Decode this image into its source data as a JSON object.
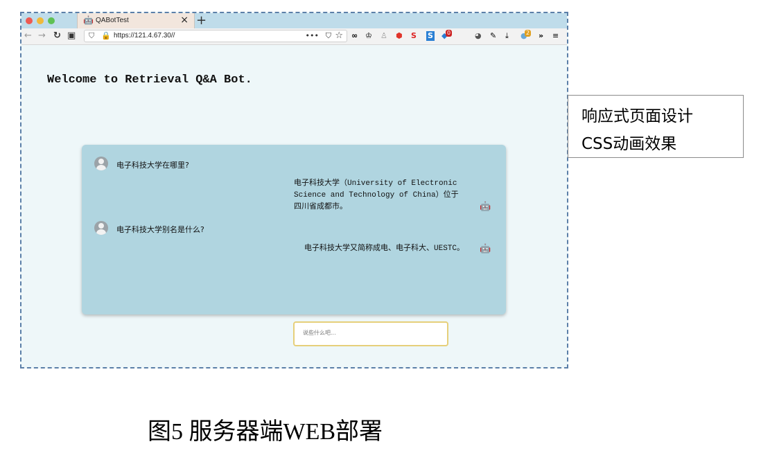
{
  "browser": {
    "tab_title": "QABotTest",
    "url": "https://121.4.67.30//",
    "extension_badge": "2",
    "extension_badge_red": "0"
  },
  "page": {
    "title": "Welcome to Retrieval Q&A Bot.",
    "messages": [
      {
        "role": "user",
        "text": "电子科技大学在哪里?"
      },
      {
        "role": "bot",
        "lines": [
          "电子科技大学（University of Electronic",
          "Science and Technology of China）位于",
          "四川省成都市。"
        ]
      },
      {
        "role": "user",
        "text": "电子科技大学别名是什么?"
      },
      {
        "role": "bot",
        "lines": [
          "电子科技大学又简称成电、电子科大、UESTC。"
        ]
      }
    ],
    "input_placeholder": "说些什么吧..."
  },
  "annotation": {
    "line1": "响应式页面设计",
    "line2": "CSS动画效果"
  },
  "caption": "图5 服务器端WEB部署",
  "colors": {
    "frame_border": "#5b7fa8",
    "page_bg": "#eef7f9",
    "chat_bg": "#b0d5e0",
    "input_border": "#e6cf7a"
  }
}
